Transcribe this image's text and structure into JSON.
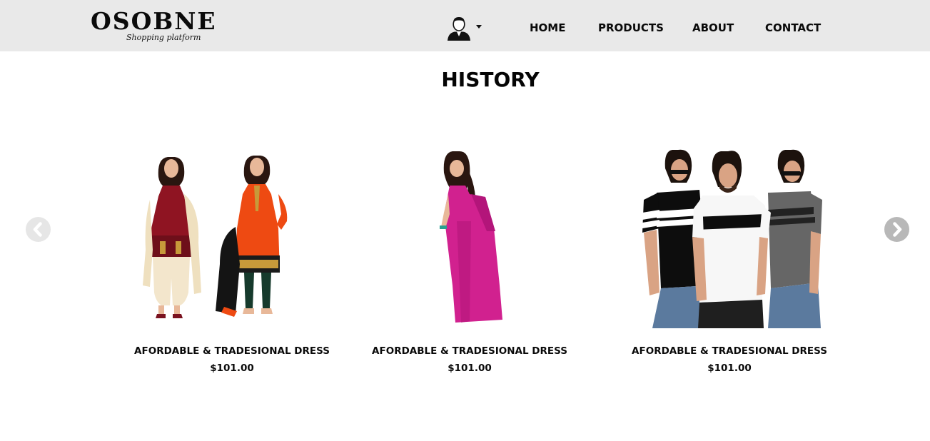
{
  "brand": {
    "name": "OSOBNE",
    "tagline": "Shopping platform"
  },
  "nav": {
    "user_icon": "user-avatar-icon",
    "links": [
      {
        "label": "HOME"
      },
      {
        "label": "PRODUCTS"
      },
      {
        "label": "ABOUT"
      },
      {
        "label": "CONTACT"
      }
    ]
  },
  "page": {
    "title": "HISTORY"
  },
  "carousel": {
    "prev_icon": "chevron-left-icon",
    "next_icon": "chevron-right-icon",
    "items": [
      {
        "name": "AFORDABLE & TRADESIONAL DRESS",
        "price": "$101.00",
        "image": "salwar-suit-photo"
      },
      {
        "name": "AFORDABLE & TRADESIONAL DRESS",
        "price": "$101.00",
        "image": "saree-photo"
      },
      {
        "name": "AFORDABLE & TRADESIONAL DRESS",
        "price": "$101.00",
        "image": "men-tshirts-photo"
      }
    ]
  },
  "colors": {
    "navbar_bg": "#e9e9e9",
    "saree_pink": "#d1218f",
    "suit_maroon": "#8f1422",
    "suit_orange": "#ee4a12"
  }
}
